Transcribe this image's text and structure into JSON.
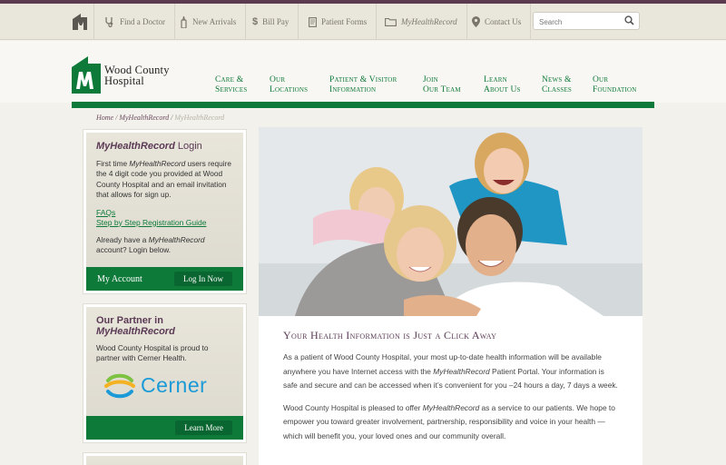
{
  "utility": {
    "links": [
      {
        "label": "Find a Doctor"
      },
      {
        "label": "New Arrivals"
      },
      {
        "label": "Bill Pay"
      },
      {
        "label": "Patient Forms"
      },
      {
        "label": "MyHealthRecord"
      },
      {
        "label": "Contact Us"
      }
    ],
    "search_placeholder": "Search"
  },
  "logo": {
    "line1": "Wood County",
    "line2": "Hospital"
  },
  "nav": [
    {
      "line1": "Care &",
      "line2": "Services"
    },
    {
      "line1": "Our",
      "line2": "Locations"
    },
    {
      "line1": "Patient & Visitor",
      "line2": "Information"
    },
    {
      "line1": "Join",
      "line2": "Our Team"
    },
    {
      "line1": "Learn",
      "line2": "About Us"
    },
    {
      "line1": "News &",
      "line2": "Classes"
    },
    {
      "line1": "Our",
      "line2": "Foundation"
    }
  ],
  "breadcrumb": {
    "home": "Home",
    "sep": " / ",
    "parent": "MyHealthRecord",
    "current": "MyHealthRecord"
  },
  "login_box": {
    "title_em": "MyHealthRecord",
    "title_rest": " Login",
    "intro_1": "First time ",
    "intro_em": "MyHealthRecord",
    "intro_2": " users require the 4 digit code you provided at Wood County Hospital and an email invitation that allows for sign up.",
    "faq_link": "FAQs",
    "guide_link": "Step by Step Registration Guide",
    "already_1": "Already have a ",
    "already_em": "MyHealthRecord",
    "already_2": " account? Login below.",
    "account_label": "My Account",
    "login_button": "Log In Now"
  },
  "partner_box": {
    "title_1": "Our Partner in",
    "title_em": "MyHealthRecord",
    "text": "Wood County Hospital is proud to partner with Cerner Health.",
    "partner_name": "Cerner",
    "learn_button": "Learn More"
  },
  "main": {
    "heading": "Your Health Information is Just a Click Away",
    "p1_a": "As a patient of Wood County Hospital, your most up-to-date health information will be available anywhere you have Internet access with the ",
    "p1_em": "MyHealthRecord",
    "p1_b": " Patient Portal. Your information is safe and secure and can be accessed when it’s convenient for you –24 hours a day, 7 days a week.",
    "p2_a": "Wood County Hospital is pleased to offer ",
    "p2_em": "MyHealthRecord",
    "p2_b": " as a service to our patients. We hope to empower you toward greater involvement, partnership, responsibility and voice in your health — which will benefit you, your loved ones and our community overall."
  },
  "colors": {
    "brand_green": "#0d7a3a",
    "plum": "#5b3a55",
    "top_strip": "#5b3a4f"
  }
}
